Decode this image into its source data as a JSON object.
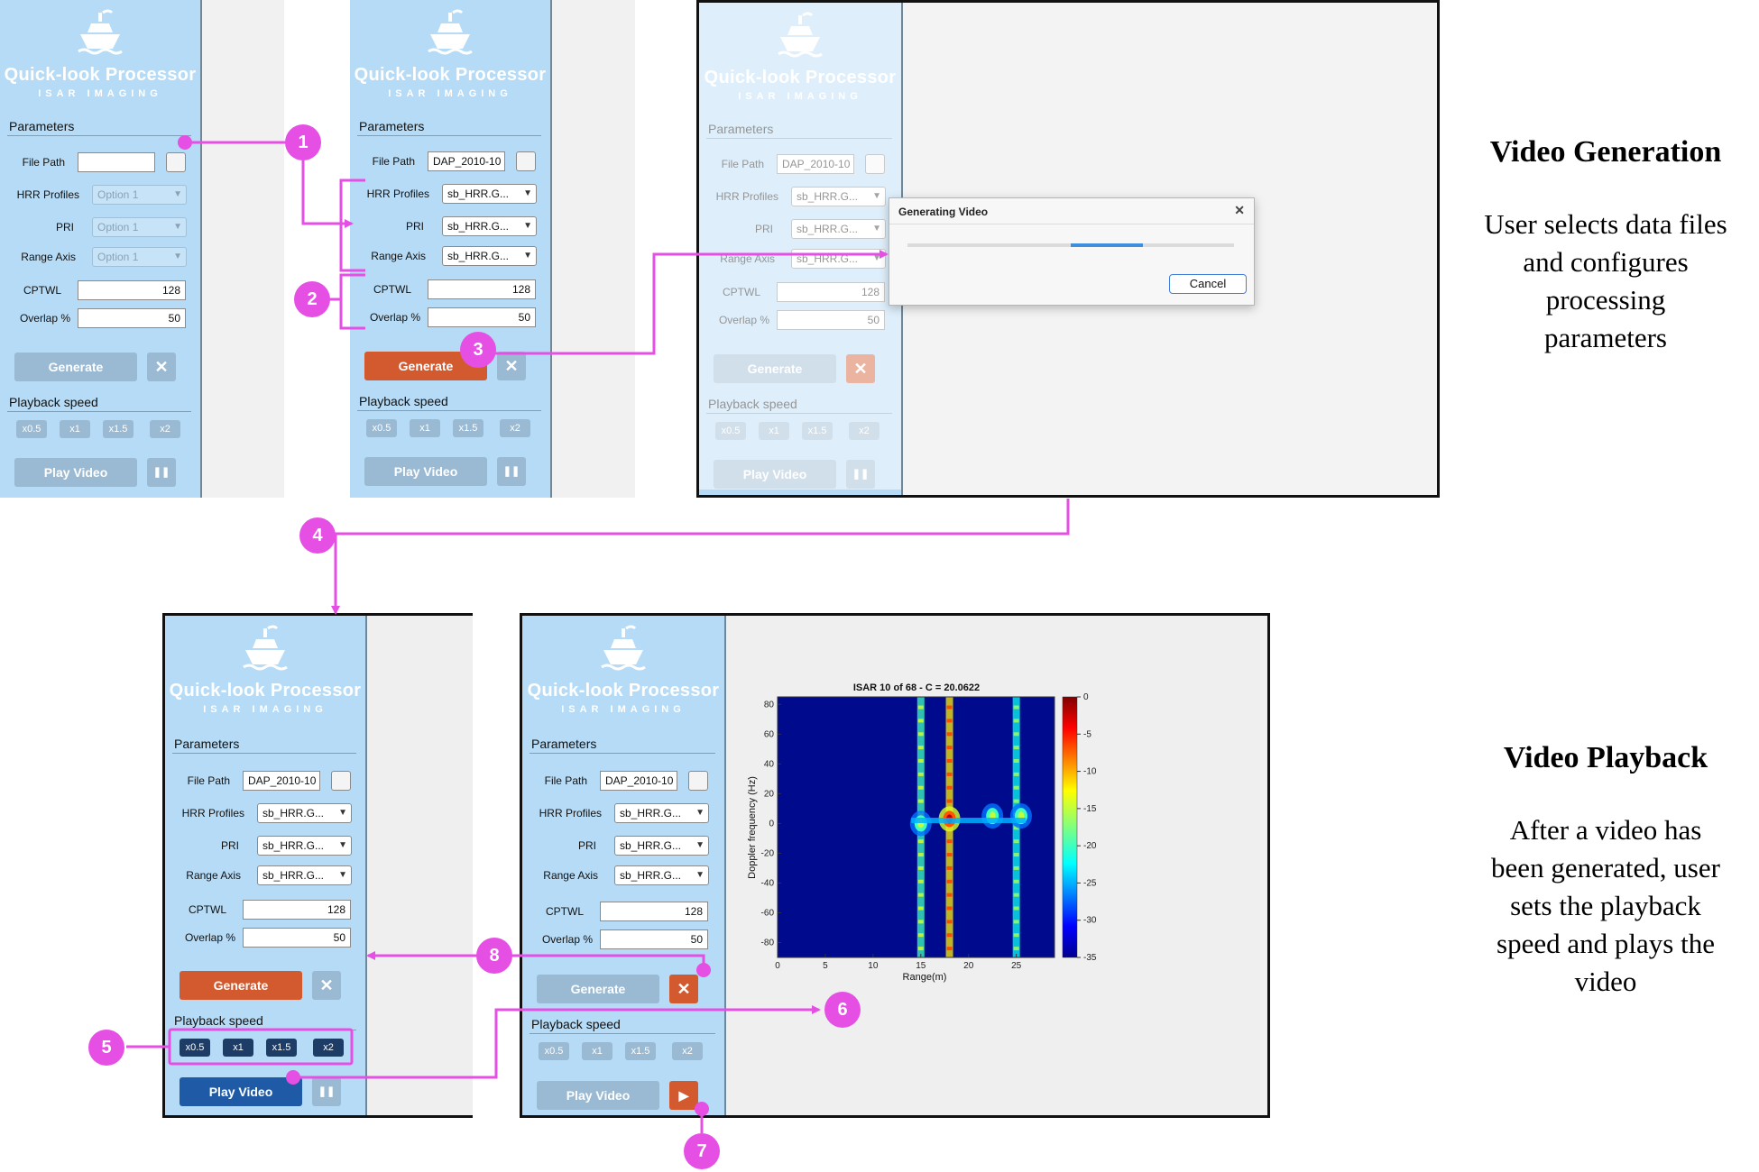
{
  "app": {
    "title": "Quick-look Processor",
    "subtitle": "ISAR IMAGING",
    "parameters_label": "Parameters",
    "labels": {
      "file_path": "File Path",
      "hrr_profiles": "HRR Profiles",
      "pri": "PRI",
      "range_axis": "Range Axis",
      "cptwl": "CPTWL",
      "overlap": "Overlap %"
    },
    "empty_option": "Option 1",
    "file_value": "DAP_2010-10",
    "select_value": "sb_HRR.G...",
    "cptwl_value": "128",
    "overlap_value": "50",
    "generate_label": "Generate",
    "close_glyph": "✕",
    "playback_label": "Playback speed",
    "speeds": [
      "x0.5",
      "x1",
      "x1.5",
      "x2"
    ],
    "play_label": "Play Video",
    "pause_glyph": "❚❚",
    "play_glyph": "▶",
    "icons": [
      "ship-logo-icon",
      "folder-browse-icon",
      "dropdown-caret-icon",
      "close-icon",
      "pause-icon",
      "play-icon"
    ]
  },
  "dialog": {
    "title": "Generating Video",
    "close": "✕",
    "cancel": "Cancel",
    "progress_start": 0.5,
    "progress_end": 0.72
  },
  "callouts": [
    "1",
    "2",
    "3",
    "4",
    "5",
    "6",
    "7",
    "8"
  ],
  "sections": {
    "generation": {
      "title": "Video Generation",
      "lines": [
        "User selects data files",
        "and configures",
        "processing",
        "parameters"
      ]
    },
    "playback": {
      "title": "Video Playback",
      "lines": [
        "After a video has",
        "been generated, user",
        "sets the playback",
        "speed and plays the",
        "video"
      ]
    }
  },
  "colors": {
    "panel": "#b6dbf6",
    "accent_orange": "#d35a2e",
    "accent_blue": "#1f5aa6",
    "callout": "#e64fe4",
    "disabled_button": "#9ab9d2"
  },
  "chart_data": {
    "type": "heatmap",
    "title": "ISAR 10 of 68 - C = 20.0622",
    "xlabel": "Range(m)",
    "ylabel": "Doppler frequency (Hz)",
    "xlim": [
      0,
      29
    ],
    "ylim": [
      -90,
      85
    ],
    "xticks": [
      0,
      5,
      10,
      15,
      20,
      25
    ],
    "yticks": [
      80,
      60,
      40,
      20,
      0,
      -20,
      -40,
      -60,
      -80
    ],
    "colorbar": {
      "min": -35,
      "max": 0,
      "ticks": [
        0,
        -5,
        -10,
        -15,
        -20,
        -25,
        -30,
        -35
      ]
    },
    "colormap": "jet",
    "features": [
      {
        "kind": "vertical-streak",
        "range_m": 15,
        "level_db": -20
      },
      {
        "kind": "vertical-streak",
        "range_m": 18,
        "level_db": -12
      },
      {
        "kind": "vertical-streak",
        "range_m": 25,
        "level_db": -22
      },
      {
        "kind": "hot-spot",
        "range_m": 18,
        "doppler_hz": 3,
        "level_db": -2
      },
      {
        "kind": "hot-spot",
        "range_m": 15,
        "doppler_hz": 0,
        "level_db": -15
      },
      {
        "kind": "hot-spot",
        "range_m": 22.5,
        "doppler_hz": 5,
        "level_db": -15
      },
      {
        "kind": "hot-spot",
        "range_m": 25.5,
        "doppler_hz": 5,
        "level_db": -15
      },
      {
        "kind": "horizontal-band",
        "range_from_m": 14,
        "range_to_m": 26,
        "doppler_hz": 2,
        "level_db": -25
      }
    ]
  }
}
